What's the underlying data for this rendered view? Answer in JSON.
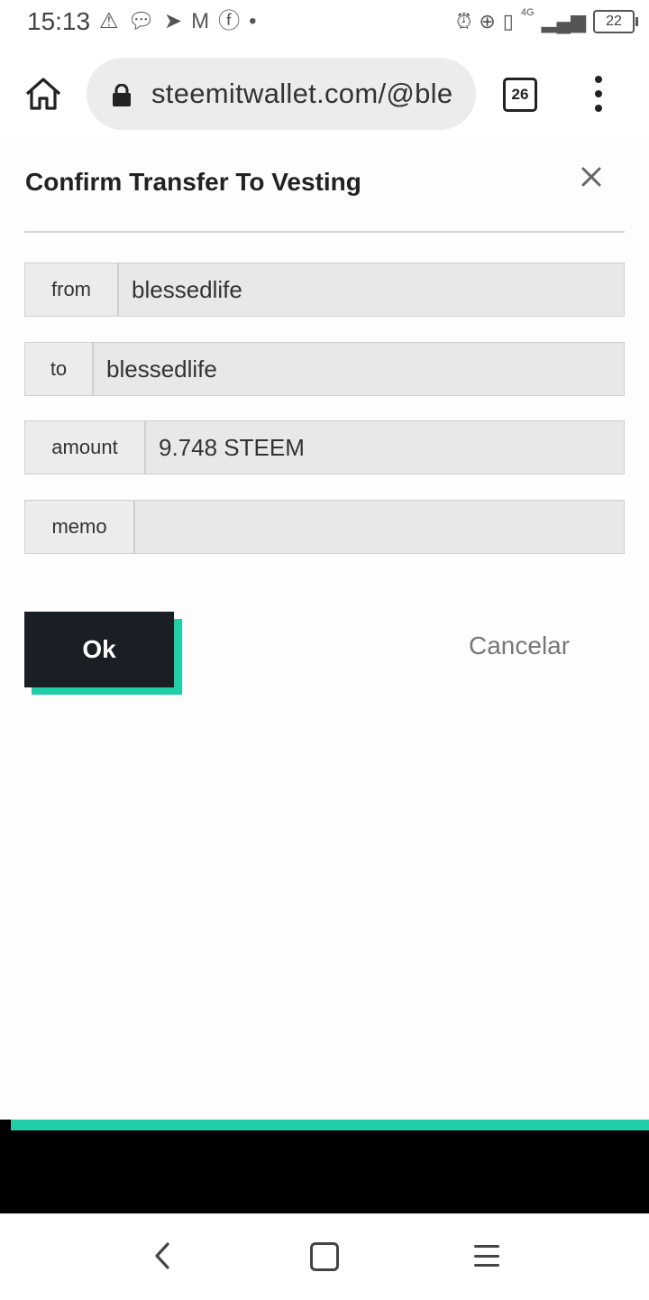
{
  "status_bar": {
    "time": "15:13",
    "network": "4G",
    "battery": "22",
    "left_icons": [
      "warning-icon",
      "chat-icon",
      "telegram-icon",
      "gmail-icon",
      "facebook-icon",
      "dot-icon"
    ],
    "right_icons": [
      "alarm-icon",
      "data-saver-icon",
      "vibrate-icon",
      "signal-icon"
    ]
  },
  "browser": {
    "url": "steemitwallet.com/@ble",
    "tab_count": "26"
  },
  "dialog": {
    "title": "Confirm Transfer To Vesting",
    "fields": [
      {
        "label": "from",
        "value": "blessedlife"
      },
      {
        "label": "to",
        "value": "blessedlife"
      },
      {
        "label": "amount",
        "value": "9.748 STEEM"
      },
      {
        "label": "memo",
        "value": ""
      }
    ],
    "ok_label": "Ok",
    "cancel_label": "Cancelar"
  },
  "colors": {
    "accent": "#1ecfa8",
    "button_dark": "#1a1f25"
  }
}
